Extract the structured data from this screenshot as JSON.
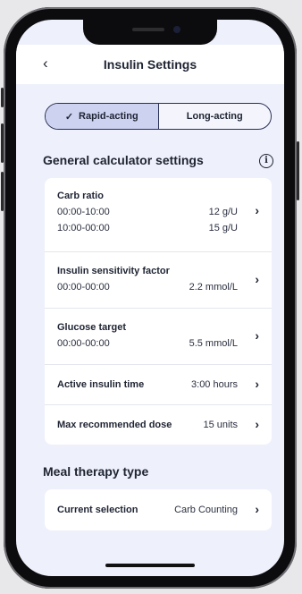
{
  "header": {
    "back_icon": "chevron-left-icon",
    "title": "Insulin Settings"
  },
  "segmented": {
    "options": [
      {
        "label": "Rapid-acting",
        "selected": true
      },
      {
        "label": "Long-acting",
        "selected": false
      }
    ]
  },
  "general": {
    "title": "General calculator settings",
    "carb_ratio": {
      "label": "Carb ratio",
      "rows": [
        {
          "time": "00:00-10:00",
          "value": "12 g/U"
        },
        {
          "time": "10:00-00:00",
          "value": "15 g/U"
        }
      ]
    },
    "isf": {
      "label": "Insulin sensitivity factor",
      "time": "00:00-00:00",
      "value": "2.2 mmol/L"
    },
    "glucose": {
      "label": "Glucose target",
      "time": "00:00-00:00",
      "value": "5.5 mmol/L"
    },
    "active_insulin": {
      "label": "Active insulin time",
      "value": "3:00 hours"
    },
    "max_dose": {
      "label": "Max recommended dose",
      "value": "15 units"
    }
  },
  "meal": {
    "title": "Meal therapy type",
    "current": {
      "label": "Current selection",
      "value": "Carb Counting"
    }
  }
}
